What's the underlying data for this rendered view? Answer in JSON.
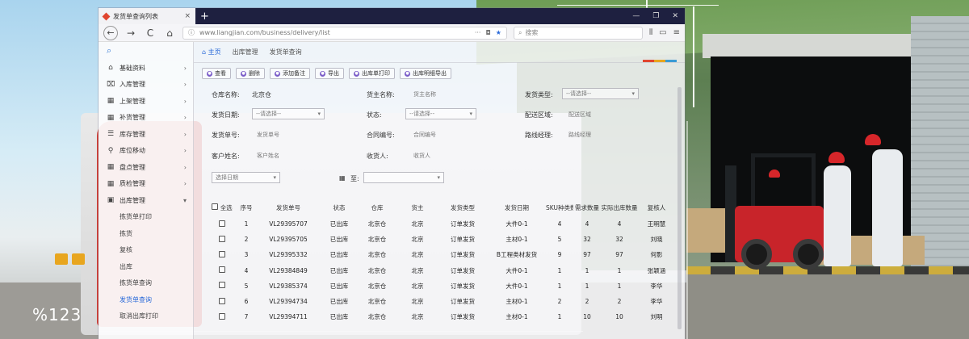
{
  "browser": {
    "tab_title": "发货单查询列表",
    "tab_close": "×",
    "new_tab": "+",
    "window_controls": [
      "—",
      "❐",
      "✕"
    ],
    "nav": {
      "back": "←",
      "forward": "→",
      "reload": "C",
      "home": "⌂"
    },
    "url": "www.liangjian.com/business/delivery/list",
    "search_placeholder": "搜索"
  },
  "sidebar": {
    "search_icon": "search-icon",
    "items": [
      {
        "label": "基础资料",
        "icon": "home-icon"
      },
      {
        "label": "入库管理",
        "icon": "inbox-icon"
      },
      {
        "label": "上架管理",
        "icon": "grid-icon"
      },
      {
        "label": "补货管理",
        "icon": "grid-icon"
      },
      {
        "label": "库存管理",
        "icon": "list-icon"
      },
      {
        "label": "库位移动",
        "icon": "link-icon"
      },
      {
        "label": "盘点管理",
        "icon": "grid-icon"
      },
      {
        "label": "质检管理",
        "icon": "grid-icon"
      },
      {
        "label": "出库管理",
        "icon": "box-icon"
      }
    ],
    "subitems": [
      {
        "label": "拣货单打印",
        "active": false
      },
      {
        "label": "拣货",
        "active": false
      },
      {
        "label": "复核",
        "active": false
      },
      {
        "label": "出库",
        "active": false
      },
      {
        "label": "拣货单查询",
        "active": false
      },
      {
        "label": "发货单查询",
        "active": true
      },
      {
        "label": "取消出库打印",
        "active": false
      }
    ]
  },
  "breadcrumb": {
    "home": "主页",
    "items": [
      "出库管理",
      "发货单查询"
    ]
  },
  "toolbar": {
    "buttons": [
      "查看",
      "删除",
      "添加备注",
      "导出",
      "出库单打印",
      "出库明细导出"
    ]
  },
  "filters": {
    "warehouse_label": "仓库名称:",
    "warehouse_value": "北京仓",
    "owner_label": "货主名称:",
    "owner_placeholder": "货主名称",
    "ship_type_label": "发货类型:",
    "ship_type_value": "--请选择--",
    "ship_date_label": "发货日期:",
    "ship_date_value": "--请选择--",
    "status_label": "状态:",
    "status_value": "--请选择--",
    "region_label": "配送区域:",
    "region_placeholder": "配送区域",
    "ship_no_label": "发货单号:",
    "ship_no_placeholder": "发货单号",
    "contract_label": "合同编号:",
    "contract_placeholder": "合同编号",
    "route_label": "路线经理:",
    "route_placeholder": "路线经理",
    "customer_label": "客户姓名:",
    "customer_placeholder": "客户姓名",
    "receiver_label": "收货人:",
    "receiver_placeholder": "收货人",
    "from_date_value": "选择日期",
    "to_label": "至:"
  },
  "table": {
    "headers": [
      "全选",
      "序号",
      "发货单号",
      "状态",
      "仓库",
      "货主",
      "发货类型",
      "发货日期",
      "SKU种类数",
      "需求数量",
      "实际出库数量",
      "复核人"
    ],
    "rows": [
      [
        "1",
        "VL29395707",
        "已出库",
        "北京仓",
        "北京",
        "订单发货",
        "大件0-1",
        "4",
        "4",
        "4",
        "王明慧"
      ],
      [
        "2",
        "VL29395705",
        "已出库",
        "北京仓",
        "北京",
        "订单发货",
        "主材0-1",
        "5",
        "32",
        "32",
        "刘晓"
      ],
      [
        "3",
        "VL29395332",
        "已出库",
        "北京仓",
        "北京",
        "订单发货",
        "B工程类材发货",
        "9",
        "97",
        "97",
        "何影"
      ],
      [
        "4",
        "VL29384849",
        "已出库",
        "北京仓",
        "北京",
        "订单发货",
        "大件0-1",
        "1",
        "1",
        "1",
        "张颖涵"
      ],
      [
        "5",
        "VL29385374",
        "已出库",
        "北京仓",
        "北京",
        "订单发货",
        "大件0-1",
        "1",
        "1",
        "1",
        "李华"
      ],
      [
        "6",
        "VL29394734",
        "已出库",
        "北京仓",
        "北京",
        "订单发货",
        "主材0-1",
        "2",
        "2",
        "2",
        "李华"
      ],
      [
        "7",
        "VL29394711",
        "已出库",
        "北京仓",
        "北京",
        "订单发货",
        "主材0-1",
        "1",
        "10",
        "10",
        "刘明"
      ]
    ]
  },
  "overlay": {
    "counter": "%123"
  },
  "colors": {
    "accent": "#2a6ad9",
    "tabbar": "#1e2040",
    "strip": [
      "#e0452f",
      "#e8a61f",
      "#3a9bd5"
    ]
  }
}
